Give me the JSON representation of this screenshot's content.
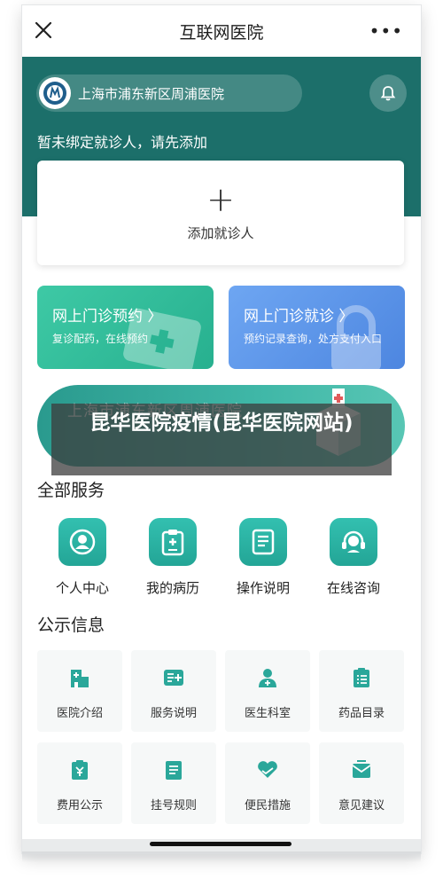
{
  "navbar": {
    "title": "互联网医院",
    "close_icon": "close-icon",
    "more_label": "•••"
  },
  "header": {
    "hospital_name": "上海市浦东新区周浦医院",
    "notification_icon": "bell-icon",
    "no_patient_text": "暂未绑定就诊人，请先添加",
    "add_patient": {
      "plus": "+",
      "label": "添加就诊人"
    },
    "bg_color": "#1c6f6a"
  },
  "features": [
    {
      "title": "网上门诊预约 〉",
      "subtitle": "复诊配药，在线预约",
      "color": "#2fbf9c"
    },
    {
      "title": "网上门诊就诊 〉",
      "subtitle": "预约记录查询，处方支付入口",
      "color": "#5a93e8"
    }
  ],
  "banner": {
    "text": "上海市浦东新区周浦医院"
  },
  "watermark": {
    "text": "昆华医院疫情(昆华医院网站)"
  },
  "services": {
    "title": "全部服务",
    "items": [
      {
        "label": "个人中心",
        "icon": "user-icon"
      },
      {
        "label": "我的病历",
        "icon": "medical-record-icon"
      },
      {
        "label": "操作说明",
        "icon": "manual-icon"
      },
      {
        "label": "在线咨询",
        "icon": "headset-icon"
      }
    ]
  },
  "public_info": {
    "title": "公示信息",
    "items": [
      {
        "label": "医院介绍",
        "icon": "hospital-icon"
      },
      {
        "label": "服务说明",
        "icon": "service-icon"
      },
      {
        "label": "医生科室",
        "icon": "doctor-icon"
      },
      {
        "label": "药品目录",
        "icon": "drug-list-icon"
      },
      {
        "label": "费用公示",
        "icon": "fee-icon"
      },
      {
        "label": "挂号规则",
        "icon": "rules-icon"
      },
      {
        "label": "便民措施",
        "icon": "heart-hand-icon"
      },
      {
        "label": "意见建议",
        "icon": "feedback-icon"
      }
    ]
  },
  "colors": {
    "accent": "#24a896",
    "icon_teal": "#2aa79a"
  }
}
